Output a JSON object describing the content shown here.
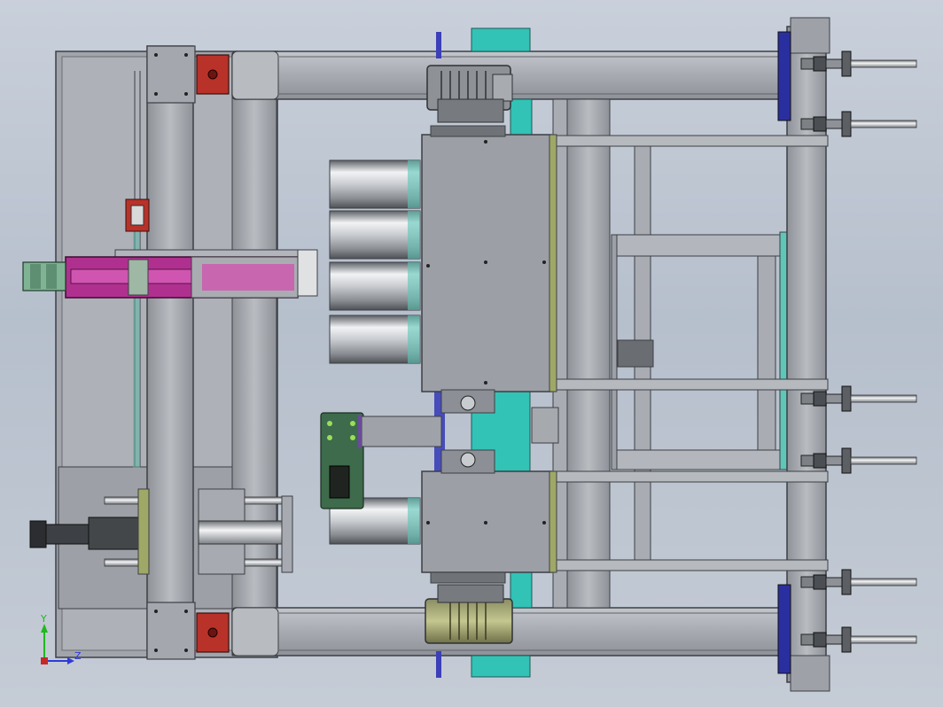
{
  "view": {
    "background_top": "#c9d0db",
    "background_bottom": "#c5ccd6"
  },
  "colors": {
    "frame_gray": "#9a9ea4",
    "frame_light": "#b3b7bd",
    "frame_dark": "#5f6368",
    "steel_edge": "#3c3f44",
    "cylinder_light": "#eef0f2",
    "cylinder_dark": "#6d7176",
    "cyan_plate": "#33c2b6",
    "magenta_slide": "#b0308f",
    "green_motor": "#7fb394",
    "red_bearing": "#b8322a",
    "blue_bracket": "#2a2fa0",
    "olive_plate": "#9fa866",
    "pcb_green": "#3d6b4b",
    "axis_y": "#1fb81f",
    "axis_z": "#2d3bd6"
  },
  "triad": {
    "y_label": "Y",
    "z_label": "Z"
  }
}
